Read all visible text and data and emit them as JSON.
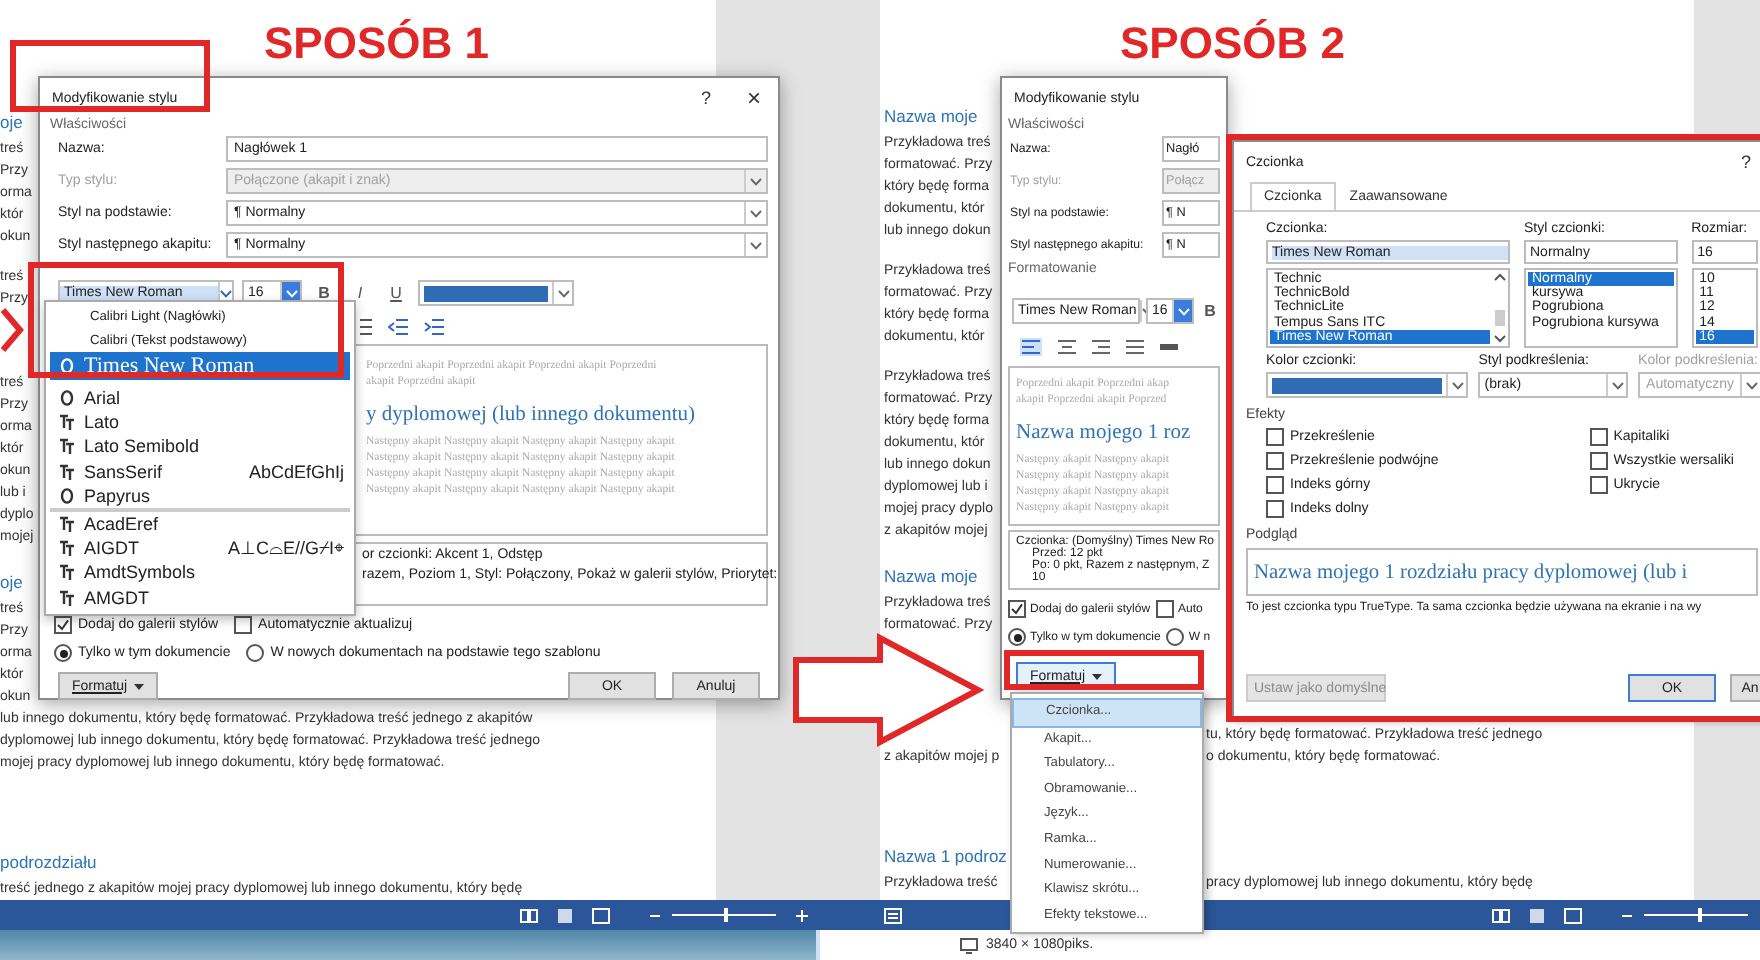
{
  "left_panel": {
    "heading": "SPOSÓB 1",
    "zoom": {
      "level": 0.5
    },
    "document": [
      {
        "kind": "heading",
        "text": "oje"
      },
      {
        "kind": "text",
        "text": "treś"
      },
      {
        "kind": "text",
        "text": "Przy"
      },
      {
        "kind": "text",
        "text": "orma"
      },
      {
        "kind": "text",
        "text": "któr"
      },
      {
        "kind": "text",
        "text": "okun"
      },
      {
        "kind": "gap"
      },
      {
        "kind": "text",
        "text": "treś"
      },
      {
        "kind": "text",
        "text": "Przy"
      },
      {
        "kind": "covered"
      },
      {
        "kind": "covered"
      },
      {
        "kind": "gap"
      },
      {
        "kind": "text",
        "text": "treś"
      },
      {
        "kind": "text",
        "text": "Przy"
      },
      {
        "kind": "text",
        "text": "orma"
      },
      {
        "kind": "text",
        "text": "któr"
      },
      {
        "kind": "text",
        "text": "okun"
      },
      {
        "kind": "text",
        "text": "lub i"
      },
      {
        "kind": "text",
        "text": "dyplo"
      },
      {
        "kind": "text",
        "text": "mojej"
      },
      {
        "kind": "gap"
      },
      {
        "kind": "heading",
        "text": "oje"
      },
      {
        "kind": "text",
        "text": "treś"
      },
      {
        "kind": "text",
        "text": "Przy"
      },
      {
        "kind": "text",
        "text": "orma"
      },
      {
        "kind": "text",
        "text": "któr"
      },
      {
        "kind": "text",
        "text": "okun"
      },
      {
        "kind": "text",
        "text": "lub innego dokumentu, który będę formatować. Przykładowa treść jednego z akapitów"
      },
      {
        "kind": "text",
        "text": "dyplomowej lub innego dokumentu, który będę formatować. Przykładowa treść jednego"
      },
      {
        "kind": "text",
        "text": "mojej pracy dyplomowej lub innego dokumentu, który będę formatować."
      },
      {
        "kind": "gap"
      },
      {
        "kind": "gap"
      },
      {
        "kind": "gap"
      },
      {
        "kind": "gap"
      },
      {
        "kind": "heading",
        "text": "podrozdziału"
      },
      {
        "kind": "text",
        "text": "treść jednego z akapitów mojej pracy dyplomowej lub innego dokumentu, który będę"
      }
    ],
    "dialog": {
      "title": "Modyfikowanie stylu",
      "help": "?",
      "close": "×",
      "section": "Właściwości",
      "fields": [
        {
          "label": "Nazwa:",
          "value": "Nagłówek 1",
          "disabled": false,
          "dropdown": false
        },
        {
          "label": "Typ stylu:",
          "value": "Połączone (akapit i znak)",
          "disabled": true,
          "dropdown": true
        },
        {
          "label": "Styl na podstawie:",
          "value": "¶ Normalny",
          "disabled": false,
          "dropdown": true
        },
        {
          "label": "Styl następnego akapitu:",
          "value": "¶ Normalny",
          "disabled": false,
          "dropdown": true
        }
      ],
      "font": "Times New Roman",
      "size": "16",
      "format_buttons": [
        "B",
        "I",
        "U"
      ],
      "font_menu": [
        {
          "kind": "theme",
          "label": "Calibri Light (Nagłówki)",
          "selected": false
        },
        {
          "kind": "theme",
          "label": "Calibri (Tekst podstawowy)",
          "selected": false
        },
        {
          "kind": "opentype",
          "label": "Times New Roman",
          "selected": true
        },
        {
          "kind": "opentype",
          "label": "Arial",
          "selected": false
        },
        {
          "kind": "truetype",
          "label": "Lato",
          "selected": false
        },
        {
          "kind": "truetype",
          "label": "Lato Semibold",
          "selected": false
        },
        {
          "kind": "truetype",
          "label": "SansSerif",
          "sample": "AbCdEfGhIj",
          "selected": false
        },
        {
          "kind": "opentype",
          "label": "Papyrus",
          "selected": false
        },
        {
          "kind": "truetype",
          "label": "AcadEref",
          "selected": false
        },
        {
          "kind": "truetype",
          "label": "AIGDT",
          "sample": "A⊥C⌓E//G⌿I⌖",
          "selected": false
        },
        {
          "kind": "truetype",
          "label": "AmdtSymbols",
          "selected": false
        },
        {
          "kind": "truetype",
          "label": "AMGDT",
          "selected": false
        }
      ],
      "preview_before": [
        "Poprzedni akapit Poprzedni akapit Poprzedni akapit Poprzedni",
        "akapit Poprzedni akapit"
      ],
      "preview_heading": "y dyplomowej (lub innego dokumentu)",
      "preview_after": [
        "Następny akapit Następny akapit Następny akapit Następny akapit",
        "Następny akapit Następny akapit Następny akapit Następny akapit",
        "Następny akapit Następny akapit Następny akapit Następny akapit",
        "Następny akapit Następny akapit Następny akapit Następny akapit"
      ],
      "description": [
        "or czcionki: Akcent 1, Odstęp",
        "razem, Poziom 1, Styl: Połączony, Pokaż w galerii stylów, Priorytet:"
      ],
      "checkboxes": [
        {
          "label": "Dodaj do galerii stylów",
          "checked": true
        },
        {
          "label": "Automatycznie aktualizuj",
          "checked": false
        }
      ],
      "radios": [
        {
          "label": "Tylko w tym dokumencie",
          "selected": true
        },
        {
          "label": "W nowych dokumentach na podstawie tego szablonu",
          "selected": false
        }
      ],
      "format_button": "Formatuj",
      "buttons": [
        "OK",
        "Anuluj"
      ]
    }
  },
  "right_panel": {
    "heading": "SPOSÓB 2",
    "zoom": {
      "level": 0.52
    },
    "document": [
      {
        "kind": "heading",
        "text": "Nazwa moje"
      },
      {
        "kind": "text",
        "text": "Przykładowa treś"
      },
      {
        "kind": "text",
        "text": "formatować. Przy"
      },
      {
        "kind": "text",
        "text": "który będę forma"
      },
      {
        "kind": "text",
        "text": "dokumentu, któr"
      },
      {
        "kind": "text",
        "text": "lub innego dokun"
      },
      {
        "kind": "gap"
      },
      {
        "kind": "text",
        "text": "Przykładowa treś"
      },
      {
        "kind": "text",
        "text": "formatować. Przy"
      },
      {
        "kind": "text",
        "text": "który będę forma"
      },
      {
        "kind": "text",
        "text": "dokumentu, któr"
      },
      {
        "kind": "gap"
      },
      {
        "kind": "text",
        "text": "Przykładowa treś"
      },
      {
        "kind": "text",
        "text": "formatować. Przy"
      },
      {
        "kind": "text",
        "text": "który będę forma"
      },
      {
        "kind": "text",
        "text": "dokumentu, któr"
      },
      {
        "kind": "text",
        "text": "lub innego dokun"
      },
      {
        "kind": "text",
        "text": "dyplomowej lub i"
      },
      {
        "kind": "text",
        "text": "mojej pracy dyplo"
      },
      {
        "kind": "text",
        "text": "z akapitów mojej"
      },
      {
        "kind": "gap"
      },
      {
        "kind": "heading",
        "text": "Nazwa moje"
      },
      {
        "kind": "text",
        "text": "Przykładowa treś"
      },
      {
        "kind": "text",
        "text": "formatować. Przy"
      },
      {
        "kind": "covered"
      },
      {
        "kind": "covered"
      },
      {
        "kind": "covered"
      },
      {
        "kind": "covered"
      },
      {
        "kind": "covered",
        "tail": "tu, który będę formatować. Przykładowa treść jednego"
      },
      {
        "kind": "text",
        "text": "z akapitów mojej p",
        "tail": "o dokumentu, który będę formatować."
      },
      {
        "kind": "gap"
      },
      {
        "kind": "gap"
      },
      {
        "kind": "gap"
      },
      {
        "kind": "gap"
      },
      {
        "kind": "heading",
        "text": "Nazwa 1 podroz"
      },
      {
        "kind": "text",
        "text": "Przykładowa treść",
        "tail": "pracy dyplomowej lub innego dokumentu, który będę"
      }
    ],
    "style_dialog": {
      "title": "Modyfikowanie stylu",
      "section": "Właściwości",
      "fields": [
        {
          "label": "Nazwa:",
          "value": "Nagłó",
          "disabled": false
        },
        {
          "label": "Typ stylu:",
          "value": "Połącz",
          "disabled": true
        },
        {
          "label": "Styl na podstawie:",
          "value": "¶ N",
          "disabled": false
        },
        {
          "label": "Styl następnego akapitu:",
          "value": "¶ N",
          "disabled": false
        }
      ],
      "formatting_label": "Formatowanie",
      "font": "Times New Roman",
      "size": "16",
      "bold_button": "B",
      "preview_before": [
        "Poprzedni akapit Poprzedni akap",
        "akapit Poprzedni akapit Poprzed"
      ],
      "preview_heading": "Nazwa mojego 1 roz",
      "preview_after": [
        "Następny akapit Następny akapit",
        "Następny akapit Następny akapit",
        "Następny akapit Następny akapit",
        "Następny akapit Następny akapit"
      ],
      "description": [
        "Czcionka: (Domyślny) Times New Ro",
        "Przed:  12 pkt",
        "Po:  0 pkt, Razem z następnym, Z",
        "10"
      ],
      "checkboxes": [
        {
          "label": "Dodaj do galerii stylów",
          "checked": true
        },
        {
          "label": "Auto",
          "checked": false
        }
      ],
      "radios": [
        {
          "label": "Tylko w tym dokumencie",
          "selected": true
        },
        {
          "label": "W n",
          "selected": false
        }
      ],
      "format_button": "Formatuj",
      "format_menu": [
        {
          "label": "Czcionka...",
          "selected": true
        },
        {
          "label": "Akapit...",
          "selected": false
        },
        {
          "label": "Tabulatory...",
          "selected": false
        },
        {
          "label": "Obramowanie...",
          "selected": false
        },
        {
          "label": "Język...",
          "selected": false
        },
        {
          "label": "Ramka...",
          "selected": false
        },
        {
          "label": "Numerowanie...",
          "selected": false
        },
        {
          "label": "Klawisz skrótu...",
          "selected": false
        },
        {
          "label": "Efekty tekstowe...",
          "selected": false
        }
      ]
    },
    "font_dialog": {
      "title": "Czcionka",
      "help": "?",
      "tabs": [
        {
          "label": "Czcionka",
          "selected": true
        },
        {
          "label": "Zaawansowane",
          "selected": false
        }
      ],
      "font_label": "Czcionka:",
      "font_value": "Times New Roman",
      "fonts": [
        {
          "label": "Technic",
          "selected": false
        },
        {
          "label": "TechnicBold",
          "selected": false
        },
        {
          "label": "TechnicLite",
          "selected": false
        },
        {
          "label": "Tempus Sans ITC",
          "selected": false
        },
        {
          "label": "Times New Roman",
          "selected": true
        }
      ],
      "style_label": "Styl czcionki:",
      "style_value": "Normalny",
      "styles": [
        {
          "label": "Normalny",
          "selected": true
        },
        {
          "label": "kursywa",
          "selected": false
        },
        {
          "label": "Pogrubiona",
          "selected": false
        },
        {
          "label": "Pogrubiona kursywa",
          "selected": false
        }
      ],
      "size_label": "Rozmiar:",
      "size_value": "16",
      "sizes": [
        {
          "label": "10",
          "selected": false
        },
        {
          "label": "11",
          "selected": false
        },
        {
          "label": "12",
          "selected": false
        },
        {
          "label": "14",
          "selected": false
        },
        {
          "label": "16",
          "selected": true
        }
      ],
      "combos": [
        {
          "label": "Kolor czcionki:",
          "kind": "swatch",
          "disabled": false
        },
        {
          "label": "Styl podkreślenia:",
          "kind": "text",
          "value": "(brak)",
          "disabled": false
        },
        {
          "label": "Kolor podkreślenia:",
          "kind": "text",
          "value": "Automatyczny",
          "disabled": true
        }
      ],
      "effects_label": "Efekty",
      "effects_left": [
        {
          "label": "Przekreślenie",
          "checked": false
        },
        {
          "label": "Przekreślenie podwójne",
          "checked": false
        },
        {
          "label": "Indeks górny",
          "checked": false
        },
        {
          "label": "Indeks dolny",
          "checked": false
        }
      ],
      "effects_right": [
        {
          "label": "Kapitaliki",
          "checked": false
        },
        {
          "label": "Wszystkie wersaliki",
          "checked": false
        },
        {
          "label": "Ukrycie",
          "checked": false
        }
      ],
      "preview_label": "Podgląd",
      "preview_text": "Nazwa mojego 1 rozdziału pracy dyplomowej (lub i",
      "note": "To jest czcionka typu TrueType. Ta sama czcionka będzie używana na ekranie i na wy",
      "default_button": {
        "label": "Ustaw jako domyślne",
        "disabled": true
      },
      "buttons": [
        "OK",
        "An"
      ]
    },
    "screen_size": "3840 × 1080piks."
  }
}
